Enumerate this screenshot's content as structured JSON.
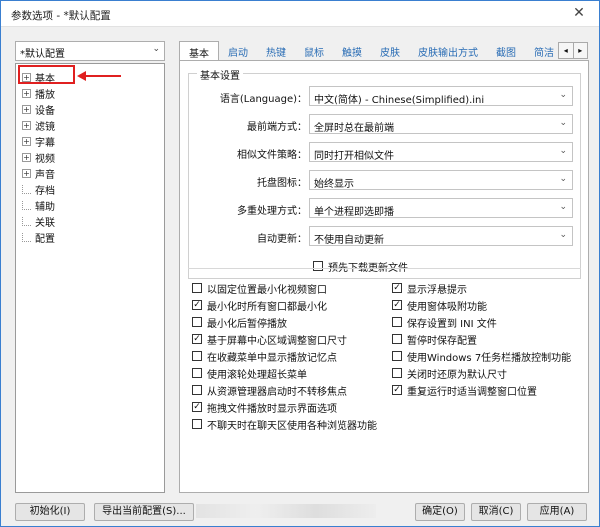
{
  "window": {
    "title": "参数选项 - *默认配置",
    "close_glyph": "✕"
  },
  "profile": {
    "value": "*默认配置"
  },
  "tree": {
    "items": [
      {
        "label": "基本",
        "expandable": true
      },
      {
        "label": "播放",
        "expandable": true
      },
      {
        "label": "设备",
        "expandable": true
      },
      {
        "label": "滤镜",
        "expandable": true
      },
      {
        "label": "字幕",
        "expandable": true
      },
      {
        "label": "视频",
        "expandable": true
      },
      {
        "label": "声音",
        "expandable": true
      },
      {
        "label": "存档",
        "expandable": false
      },
      {
        "label": "辅助",
        "expandable": false
      },
      {
        "label": "关联",
        "expandable": false
      },
      {
        "label": "配置",
        "expandable": false
      }
    ]
  },
  "tabs": [
    "基本",
    "启动",
    "热键",
    "鼠标",
    "触摸",
    "皮肤",
    "皮肤输出方式",
    "截图",
    "简洁"
  ],
  "basic": {
    "legend": "基本设置",
    "fields": [
      {
        "label": "语言(Language)：",
        "value": "中文(简体) - Chinese(Simplified).ini"
      },
      {
        "label": "最前端方式：",
        "value": "全屏时总在最前端"
      },
      {
        "label": "相似文件策略：",
        "value": "同时打开相似文件"
      },
      {
        "label": "托盘图标：",
        "value": "始终显示"
      },
      {
        "label": "多重处理方式：",
        "value": "单个进程即选即播"
      },
      {
        "label": "自动更新：",
        "value": "不使用自动更新"
      }
    ],
    "preview_update": {
      "label": "预先下载更新文件",
      "checked": false
    }
  },
  "options_left": [
    {
      "label": "以固定位置最小化视频窗口",
      "checked": false
    },
    {
      "label": "最小化时所有窗口都最小化",
      "checked": true
    },
    {
      "label": "最小化后暂停播放",
      "checked": false
    },
    {
      "label": "基于屏幕中心区域调整窗口尺寸",
      "checked": true
    },
    {
      "label": "在收藏菜单中显示播放记忆点",
      "checked": false
    },
    {
      "label": "使用滚轮处理超长菜单",
      "checked": false
    },
    {
      "label": "从资源管理器启动时不转移焦点",
      "checked": false
    },
    {
      "label": "拖拽文件播放时显示界面选项",
      "checked": true
    },
    {
      "label": "不聊天时在聊天区使用各种浏览器功能",
      "checked": false
    }
  ],
  "options_right": [
    {
      "label": "显示浮悬提示",
      "checked": true
    },
    {
      "label": "使用窗体吸附功能",
      "checked": true
    },
    {
      "label": "保存设置到 INI 文件",
      "checked": false
    },
    {
      "label": "暂停时保存配置",
      "checked": false
    },
    {
      "label": "使用Windows 7任务栏播放控制功能",
      "checked": false
    },
    {
      "label": "关闭时还原为默认尺寸",
      "checked": false
    },
    {
      "label": "重复运行时适当调整窗口位置",
      "checked": true
    }
  ],
  "buttons": {
    "init": "初始化(I)",
    "export": "导出当前配置(S)...",
    "ok": "确定(O)",
    "cancel": "取消(C)",
    "apply": "应用(A)"
  }
}
